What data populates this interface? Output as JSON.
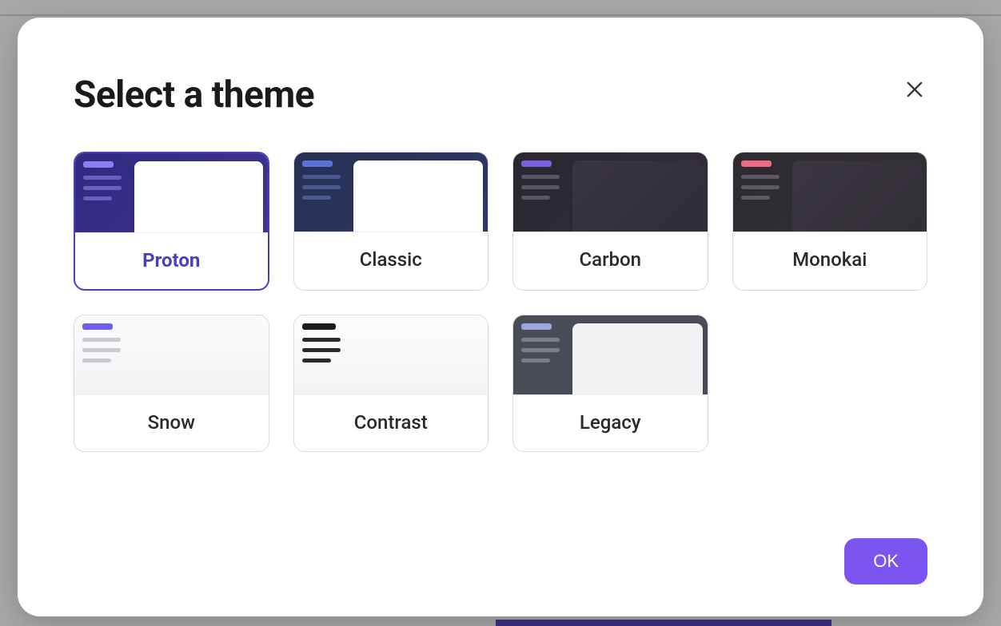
{
  "modal": {
    "title": "Select a theme",
    "ok_label": "OK"
  },
  "themes": [
    {
      "id": "proton",
      "label": "Proton",
      "selected": true
    },
    {
      "id": "classic",
      "label": "Classic",
      "selected": false
    },
    {
      "id": "carbon",
      "label": "Carbon",
      "selected": false
    },
    {
      "id": "monokai",
      "label": "Monokai",
      "selected": false
    },
    {
      "id": "snow",
      "label": "Snow",
      "selected": false
    },
    {
      "id": "contrast",
      "label": "Contrast",
      "selected": false
    },
    {
      "id": "legacy",
      "label": "Legacy",
      "selected": false
    }
  ]
}
